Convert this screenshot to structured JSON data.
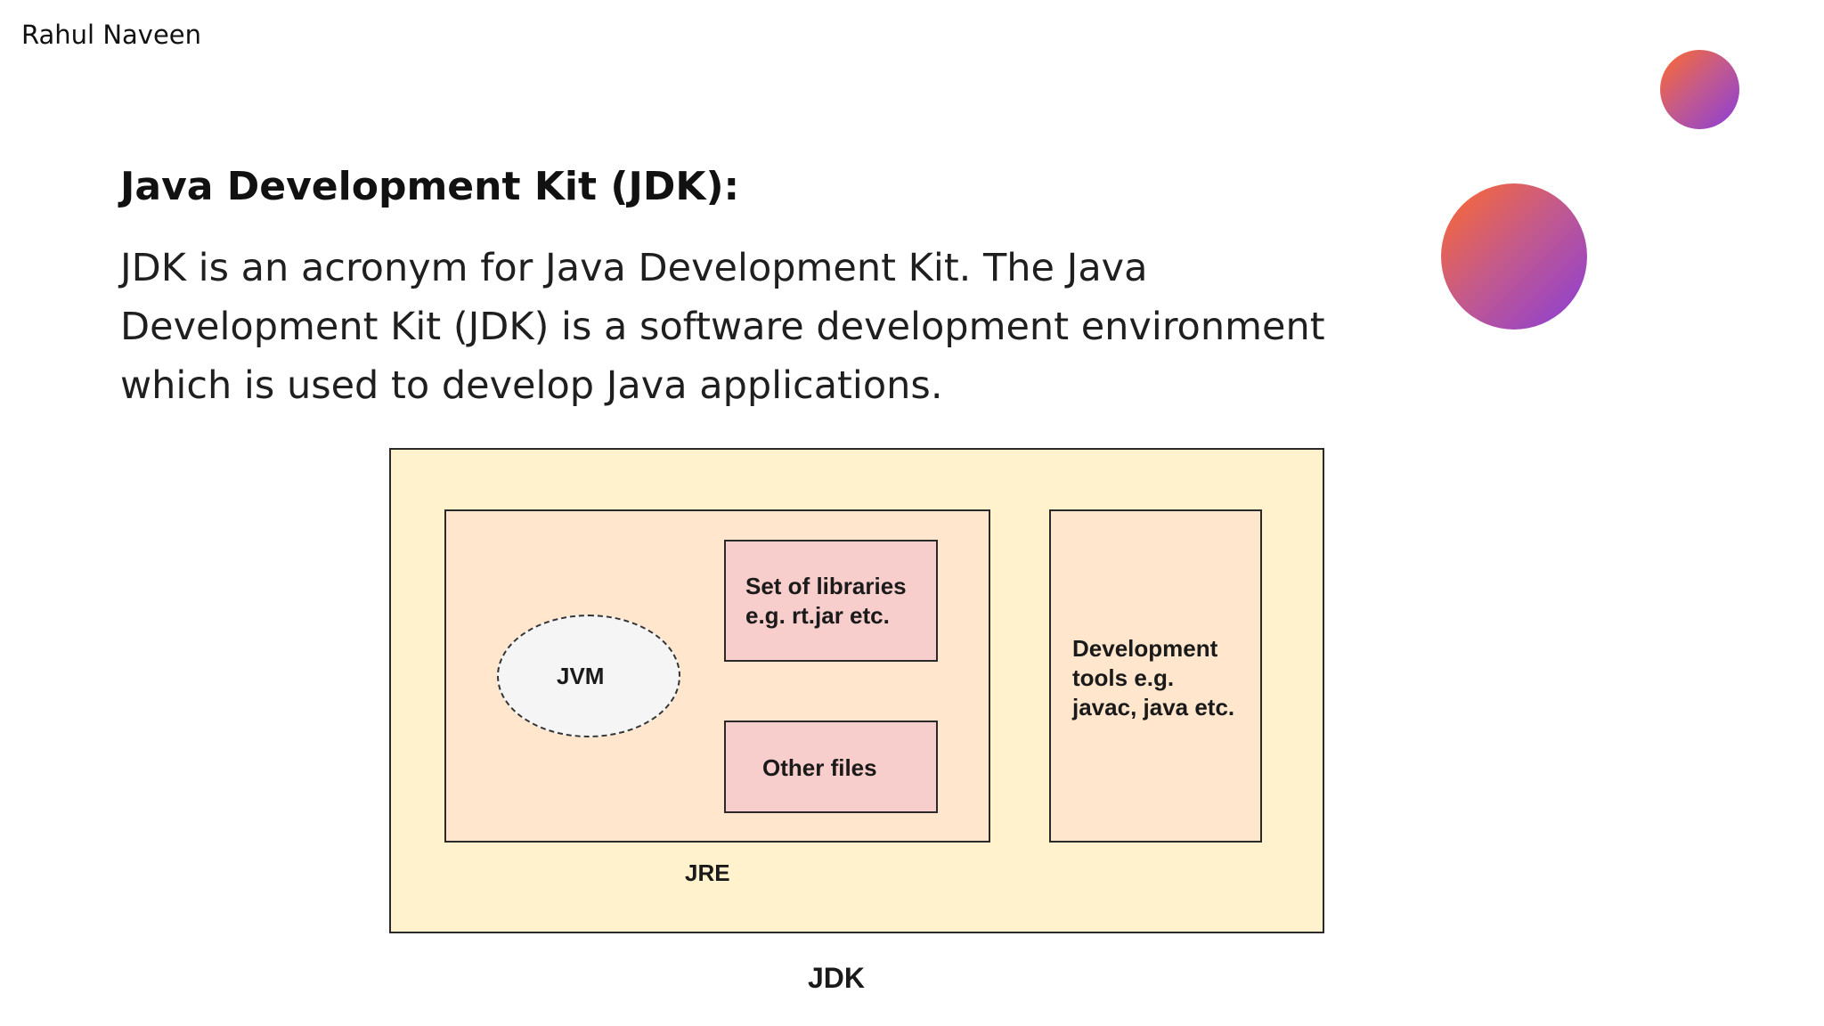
{
  "slide": {
    "author": "Rahul Naveen",
    "heading": "Java Development Kit (JDK):",
    "paragraph": "JDK is an acronym for Java Development Kit. The Java Development Kit (JDK) is a software development environment which is used to develop Java applications."
  },
  "decorations": {
    "gradient_colors": [
      "#ff6a2c",
      "#c35a8d",
      "#8a3dd8"
    ]
  },
  "diagram": {
    "jdk_label": "JDK",
    "jre_label": "JRE",
    "jvm_label": "JVM",
    "libraries_line1": "Set of libraries",
    "libraries_line2": "e.g. rt.jar etc.",
    "other_files_label": "Other files",
    "tools_line1": "Development",
    "tools_line2": "tools e.g.",
    "tools_line3": "javac, java etc.",
    "colors": {
      "jdk_fill": "#fff2cc",
      "jre_fill": "#ffe6cc",
      "tools_fill": "#ffe6cc",
      "files_fill": "#f8cecc",
      "jvm_fill": "#f5f5f5"
    }
  }
}
